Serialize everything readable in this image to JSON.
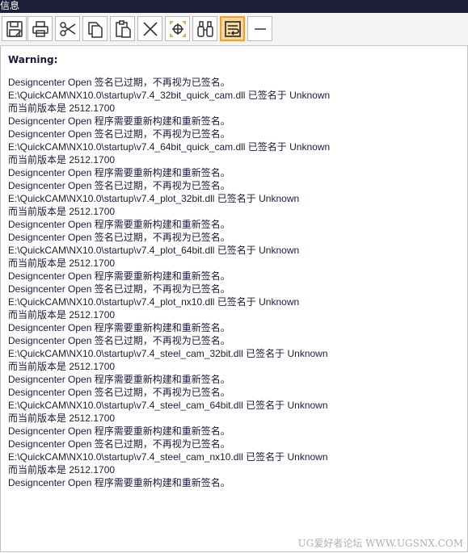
{
  "window": {
    "title": "信息"
  },
  "toolbar": {
    "buttons": [
      {
        "name": "save-icon"
      },
      {
        "name": "print-icon"
      },
      {
        "name": "cut-icon"
      },
      {
        "name": "copy-icon"
      },
      {
        "name": "paste-icon"
      },
      {
        "name": "delete-icon"
      },
      {
        "name": "locate-icon"
      },
      {
        "name": "find-icon"
      },
      {
        "name": "wrap-text-icon",
        "active": true
      },
      {
        "name": "minimize-icon"
      }
    ]
  },
  "content": {
    "heading": "Warning:",
    "lines": [
      "Designcenter Open 签名已过期，不再视为已签名。",
      "E:\\QuickCAM\\NX10.0\\startup\\v7.4_32bit_quick_cam.dll 已签名于 Unknown",
      "而当前版本是 2512.1700",
      "Designcenter Open 程序需要重新构建和重新签名。",
      "Designcenter Open 签名已过期，不再视为已签名。",
      "E:\\QuickCAM\\NX10.0\\startup\\v7.4_64bit_quick_cam.dll 已签名于 Unknown",
      "而当前版本是 2512.1700",
      "Designcenter Open 程序需要重新构建和重新签名。",
      "Designcenter Open 签名已过期，不再视为已签名。",
      "E:\\QuickCAM\\NX10.0\\startup\\v7.4_plot_32bit.dll 已签名于 Unknown",
      "而当前版本是 2512.1700",
      "Designcenter Open 程序需要重新构建和重新签名。",
      "Designcenter Open 签名已过期，不再视为已签名。",
      "E:\\QuickCAM\\NX10.0\\startup\\v7.4_plot_64bit.dll 已签名于 Unknown",
      "而当前版本是 2512.1700",
      "Designcenter Open 程序需要重新构建和重新签名。",
      "Designcenter Open 签名已过期，不再视为已签名。",
      "E:\\QuickCAM\\NX10.0\\startup\\v7.4_plot_nx10.dll 已签名于 Unknown",
      "而当前版本是 2512.1700",
      "Designcenter Open 程序需要重新构建和重新签名。",
      "Designcenter Open 签名已过期，不再视为已签名。",
      "E:\\QuickCAM\\NX10.0\\startup\\v7.4_steel_cam_32bit.dll 已签名于 Unknown",
      "而当前版本是 2512.1700",
      "Designcenter Open 程序需要重新构建和重新签名。",
      "Designcenter Open 签名已过期，不再视为已签名。",
      "E:\\QuickCAM\\NX10.0\\startup\\v7.4_steel_cam_64bit.dll 已签名于 Unknown",
      "而当前版本是 2512.1700",
      "Designcenter Open 程序需要重新构建和重新签名。",
      "Designcenter Open 签名已过期，不再视为已签名。",
      "E:\\QuickCAM\\NX10.0\\startup\\v7.4_steel_cam_nx10.dll 已签名于 Unknown",
      "而当前版本是 2512.1700",
      "Designcenter Open 程序需要重新构建和重新签名。"
    ]
  },
  "watermark": "UG爱好者论坛 WWW.UGSNX.COM"
}
